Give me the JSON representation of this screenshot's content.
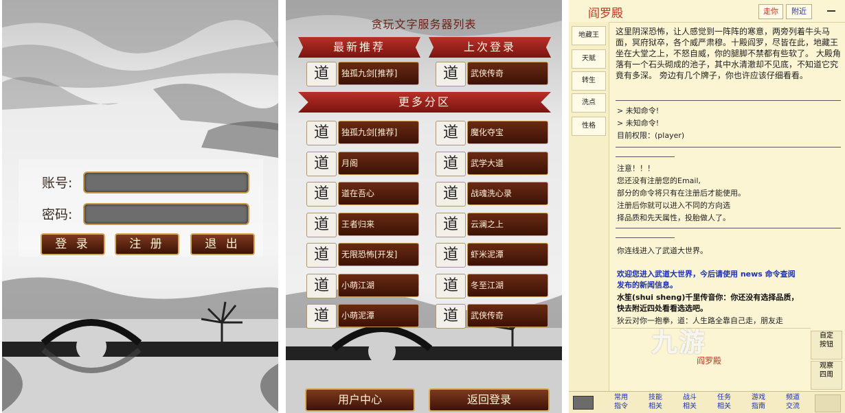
{
  "login": {
    "account_label": "账号:",
    "password_label": "密码:",
    "login_button": "登 录",
    "register_button": "注 册",
    "exit_button": "退 出"
  },
  "server_list": {
    "title": "贪玩文字服务器列表",
    "recommended_banner": "最新推荐",
    "last_login_banner": "上次登录",
    "more_banner": "更多分区",
    "recommended": {
      "logo": "道",
      "name": "独孤九剑[推荐]"
    },
    "last_login": {
      "logo": "道",
      "name": "武侠传奇"
    },
    "servers": [
      {
        "logo": "道",
        "name": "独孤九剑[推荐]"
      },
      {
        "logo": "道",
        "name": "魔化夺宝"
      },
      {
        "logo": "道",
        "name": "月阁"
      },
      {
        "logo": "道",
        "name": "武学大道"
      },
      {
        "logo": "道",
        "name": "道在吾心"
      },
      {
        "logo": "道",
        "name": "战魂洗心录"
      },
      {
        "logo": "道",
        "name": "王者归来"
      },
      {
        "logo": "道",
        "name": "云澜之上"
      },
      {
        "logo": "道",
        "name": "无限恐怖[开发]"
      },
      {
        "logo": "道",
        "name": "虾米泥潭"
      },
      {
        "logo": "道",
        "name": "小萌江湖"
      },
      {
        "logo": "道",
        "name": "冬至江湖"
      },
      {
        "logo": "道",
        "name": "小萌泥潭"
      },
      {
        "logo": "道",
        "name": "武侠传奇"
      }
    ],
    "user_center_button": "用户中心",
    "back_login_button": "返回登录"
  },
  "game": {
    "room_title": "阎罗殿",
    "walk_button": "走你",
    "nearby_button": "附近",
    "sidebar": [
      "地藏王",
      "天赋",
      "转生",
      "洗点",
      "性格"
    ],
    "description": "这里阴深恐怖，让人感觉到一阵阵的寒意，两旁列着牛头马面，冥府狱卒，各个威严肃穆。十殿阎罗，尽皆在此，地藏王坐在大堂之上，不怒自威，你的腿脚不禁都有些软了。  大殿角落有一个石头砌成的池子，其中水清澈却不见底，不知道它究竟有多深。  旁边有几个牌子，你也许应该仔细看看。",
    "unknown_cmd_1": "> 未知命令!",
    "unknown_cmd_2": "> 未知命令!",
    "permission": "目前权限：(player)",
    "notice_title": "注意！！！",
    "notice_1": "您还没有注册您的Email,",
    "notice_2": "部分的命令将只有在注册后才能使用。",
    "notice_3": "注册后你就可以进入不同的方向选",
    "notice_4": "择品质和先天属性，投胎做人了。",
    "connect_msg": "你连线进入了武道大世界。",
    "welcome_1": "欢迎您进入武道大世界，今后请使用 news 命令查阅",
    "welcome_2": "发布的新闻信息。",
    "whisper_1": "水笙(shui sheng)千里传音你：你还没有选择品质，",
    "whisper_2": "快去附近四处看看选选吧。",
    "chat_line": "狄云对你一抱拳，道：人生路全靠自己走，朋友走",
    "input_tag": "阎罗殿",
    "custom_button": "自定\n按钮",
    "look_button": "观察\n四周",
    "tabs": [
      "常用\n指令",
      "技能\n相关",
      "战斗\n相关",
      "任务\n相关",
      "游戏\n指南",
      "频道\n交流"
    ],
    "watermark": "九游"
  }
}
